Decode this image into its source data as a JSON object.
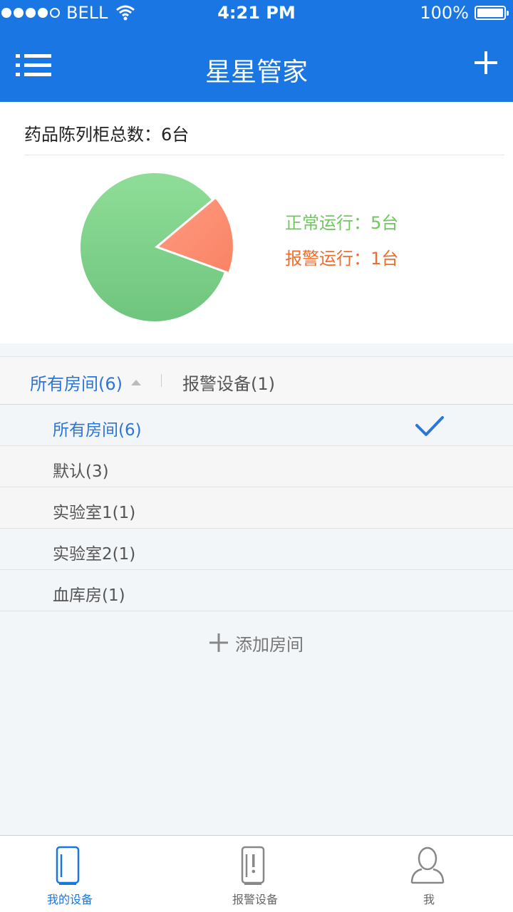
{
  "status_bar": {
    "carrier": "BELL",
    "time": "4:21 PM",
    "battery": "100%"
  },
  "nav": {
    "title": "星星管家",
    "left_icon": "menu-list-icon",
    "right_icon": "plus-icon"
  },
  "summary": {
    "title": "药品陈列柜总数：6台",
    "normal_label": "正常运行：5台",
    "alarm_label": "报警运行：1台",
    "colors": {
      "normal": "#70c760",
      "alarm": "#f06d2d"
    }
  },
  "chart_data": {
    "type": "pie",
    "categories": [
      "正常运行",
      "报警运行"
    ],
    "values": [
      5,
      1
    ],
    "colors": [
      "#7fd48d",
      "#ff8a6b"
    ]
  },
  "filter": {
    "all_rooms_tab": "所有房间(6)",
    "alarm_tab": "报警设备(1)"
  },
  "rooms": [
    {
      "label": "所有房间(6)",
      "selected": true
    },
    {
      "label": "默认(3)",
      "selected": false
    },
    {
      "label": "实验室1(1)",
      "selected": false
    },
    {
      "label": "实验室2(1)",
      "selected": false
    },
    {
      "label": "血库房(1)",
      "selected": false
    }
  ],
  "add_room": {
    "label": "添加房间",
    "icon": "plus-icon"
  },
  "tabs": [
    {
      "label": "我的设备",
      "icon": "fridge-icon",
      "active": true
    },
    {
      "label": "报警设备",
      "icon": "alarm-fridge-icon",
      "active": false
    },
    {
      "label": "我",
      "icon": "user-icon",
      "active": false
    }
  ],
  "accent_color": "#1a76e3"
}
